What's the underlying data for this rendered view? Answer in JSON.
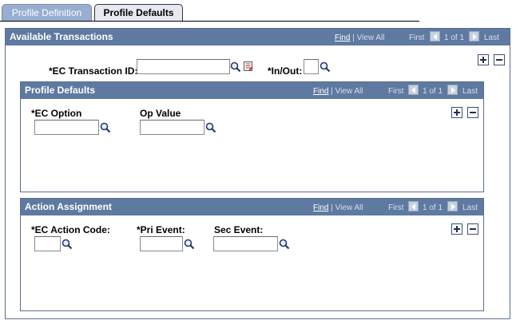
{
  "tabs": [
    {
      "label": "Profile Definition"
    },
    {
      "label": "Profile Defaults"
    }
  ],
  "nav": {
    "find": "Find",
    "sep": "|",
    "view_all": "View All",
    "first": "First",
    "count": "1 of 1",
    "last": "Last"
  },
  "available_transactions": {
    "title": "Available Transactions",
    "ec_transaction_id_label": "*EC Transaction ID:",
    "ec_transaction_id_value": "",
    "in_out_label": "*In/Out:",
    "in_out_value": ""
  },
  "profile_defaults": {
    "title": "Profile Defaults",
    "ec_option_label": "*EC Option",
    "ec_option_value": "",
    "op_value_label": "Op Value",
    "op_value_value": ""
  },
  "action_assignment": {
    "title": "Action Assignment",
    "ec_action_code_label": "*EC Action Code:",
    "ec_action_code_value": "",
    "pri_event_label": "*Pri Event:",
    "pri_event_value": "",
    "sec_event_label": "Sec Event:",
    "sec_event_value": ""
  },
  "colors": {
    "panel_header": "#5f7aa1",
    "tab_inactive": "#97aed0",
    "tab_active": "#e6e9f0"
  },
  "icons": [
    "lookup-icon",
    "detail-page-icon",
    "first-arrow-icon",
    "last-arrow-icon",
    "add-row-icon",
    "delete-row-icon"
  ]
}
